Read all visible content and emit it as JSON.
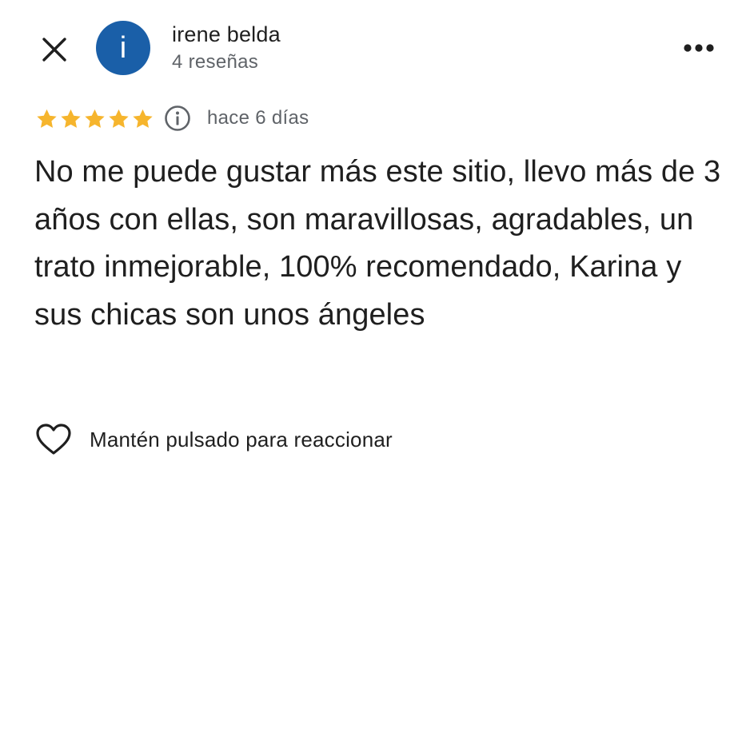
{
  "header": {
    "close_icon": "close-icon",
    "more_icon": "more-horizontal-icon",
    "avatar_letter": "i",
    "avatar_color": "#1a5fa8",
    "author_name": "irene belda",
    "author_reviews": "4 reseñas"
  },
  "review": {
    "rating": 5,
    "rating_max": 5,
    "star_color": "#f6b52d",
    "info_icon": "info-icon",
    "date": "hace 6 días",
    "text": "No me puede gustar más este sitio, llevo más de 3 años con ellas, son maravillosas, agradables, un trato inmejorable, 100% recomendado, Karina y sus chicas son unos ángeles"
  },
  "reaction": {
    "icon": "heart-icon",
    "label": "Mantén pulsado para reaccionar"
  }
}
